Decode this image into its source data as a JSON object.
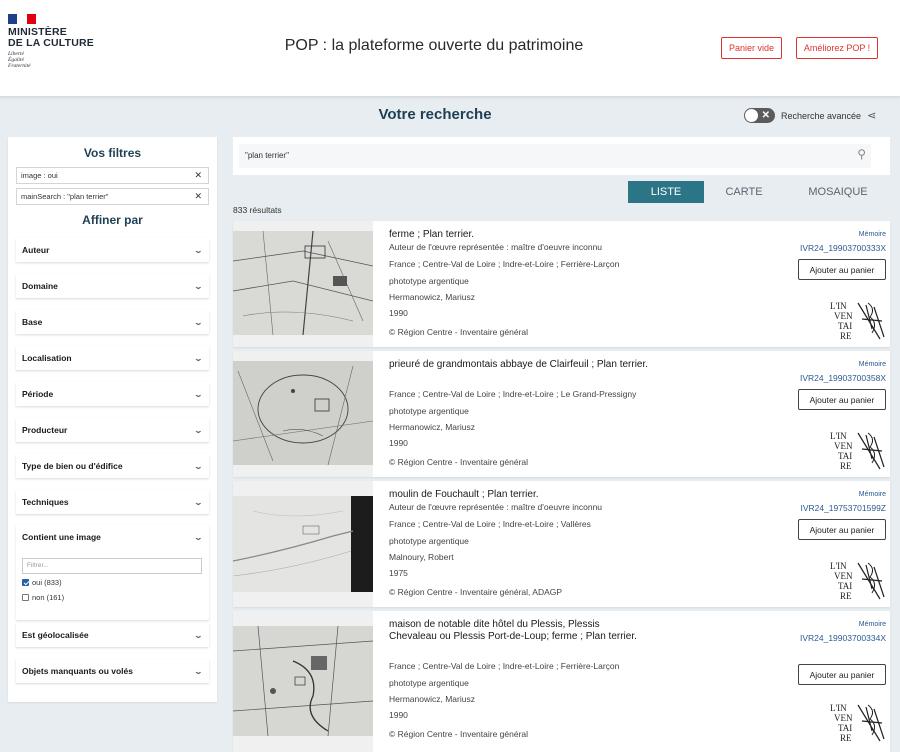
{
  "header": {
    "ministry_line1": "MINISTÈRE",
    "ministry_line2": "DE LA CULTURE",
    "motto": [
      "Liberté",
      "Égalité",
      "Fraternité"
    ],
    "title": "POP : la plateforme ouverte du patrimoine",
    "cart_button": "Panier vide",
    "improve_button": "Améliorez POP !"
  },
  "search": {
    "heading": "Votre recherche",
    "advanced_label": "Recherche avancée",
    "query": "\"plan terrier\"",
    "result_count": "833 résultats",
    "tabs": [
      "LISTE",
      "CARTE",
      "MOSAIQUE"
    ],
    "active_tab": "LISTE"
  },
  "filters": {
    "title": "Vos filtres",
    "active": [
      "image : oui",
      "mainSearch : \"plan terrier\""
    ],
    "refine_title": "Affiner par",
    "sections": [
      "Auteur",
      "Domaine",
      "Base",
      "Localisation",
      "Période",
      "Producteur",
      "Type de bien ou d'édifice",
      "Techniques"
    ],
    "image_section": {
      "label": "Contient une image",
      "filter_placeholder": "Filtrer...",
      "options": [
        {
          "label": "oui (833)",
          "checked": true
        },
        {
          "label": "non (161)",
          "checked": false
        }
      ]
    },
    "sections_after": [
      "Est géolocalisée",
      "Objets manquants ou volés"
    ]
  },
  "results": [
    {
      "title": "ferme ; Plan terrier.",
      "lines": [
        "Auteur de l'œuvre représentée : maître d'oeuvre inconnu",
        "France ; Centre-Val de Loire ; Indre-et-Loire ; Ferrière-Larçon",
        "phototype argentique",
        "Hermanowicz, Mariusz",
        "1990",
        "© Région Centre - Inventaire général"
      ],
      "base": "Mémoire",
      "ref": "IVR24_19903700333X",
      "cart": "Ajouter au panier"
    },
    {
      "title": "prieuré de grandmontais abbaye de Clairfeuil ; Plan terrier.",
      "lines": [
        "France ; Centre-Val de Loire ; Indre-et-Loire ; Le Grand-Pressigny",
        "phototype argentique",
        "Hermanowicz, Mariusz",
        "1990",
        "© Région Centre - Inventaire général"
      ],
      "base": "Mémoire",
      "ref": "IVR24_19903700358X",
      "cart": "Ajouter au panier"
    },
    {
      "title": "moulin de Fouchault ; Plan terrier.",
      "lines": [
        "Auteur de l'œuvre représentée : maître d'oeuvre inconnu",
        "France ; Centre-Val de Loire ; Indre-et-Loire ; Vallères",
        "phototype argentique",
        "Malnoury, Robert",
        "1975",
        "© Région Centre - Inventaire général, ADAGP"
      ],
      "base": "Mémoire",
      "ref": "IVR24_19753701599Z",
      "cart": "Ajouter au panier"
    },
    {
      "title": "maison de notable dite hôtel du Plessis, Plessis Chevaleau ou Plessis Port-de-Loup; ferme ; Plan terrier.",
      "lines": [
        "France ; Centre-Val de Loire ; Indre-et-Loire ; Ferrière-Larçon",
        "phototype argentique",
        "Hermanowicz, Mariusz",
        "1990",
        "© Région Centre - Inventaire général"
      ],
      "base": "Mémoire",
      "ref": "IVR24_19903700334X",
      "cart": "Ajouter au panier"
    }
  ],
  "inventory_logo": [
    "L'IN",
    "VEN",
    "TAI",
    "RE"
  ],
  "colors": {
    "accent": "#2b7587",
    "brand_red": "#e0342f",
    "link": "#2b5a92"
  }
}
